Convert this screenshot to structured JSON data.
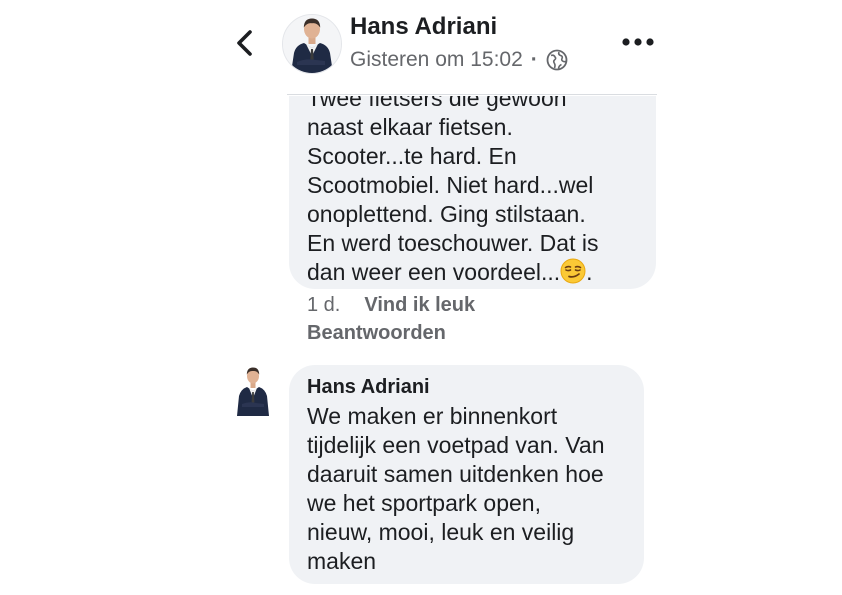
{
  "header": {
    "name": "Hans Adriani",
    "timestamp": "Gisteren om 15:02",
    "separator": "·",
    "back_icon": "chevron-left-icon",
    "privacy_icon": "globe-icon",
    "more_icon": "more-dots-icon"
  },
  "comment_1": {
    "lines": [
      "Twee fietsers die gewoon",
      "naast elkaar fietsen.",
      "Scooter...te hard. En",
      "Scootmobiel. Niet hard...wel",
      "onoplettend. Ging stilstaan.",
      "En werd toeschouwer. Dat is",
      "dan weer een voordeel...",
      "."
    ],
    "emoji": "smirking-face-emoji",
    "time": "1 d.",
    "like_label": "Vind ik leuk",
    "reply_label": "Beantwoorden"
  },
  "comment_2": {
    "author": "Hans Adriani",
    "lines": [
      "We maken er binnenkort",
      "tijdelijk een voetpad van. Van",
      "daaruit samen uitdenken hoe",
      "we het sportpark open,",
      "nieuw, mooi, leuk en veilig",
      "maken"
    ]
  },
  "colors": {
    "bubble": "#f0f2f5",
    "secondary_text": "#65676b",
    "primary_text": "#1c1e21"
  }
}
